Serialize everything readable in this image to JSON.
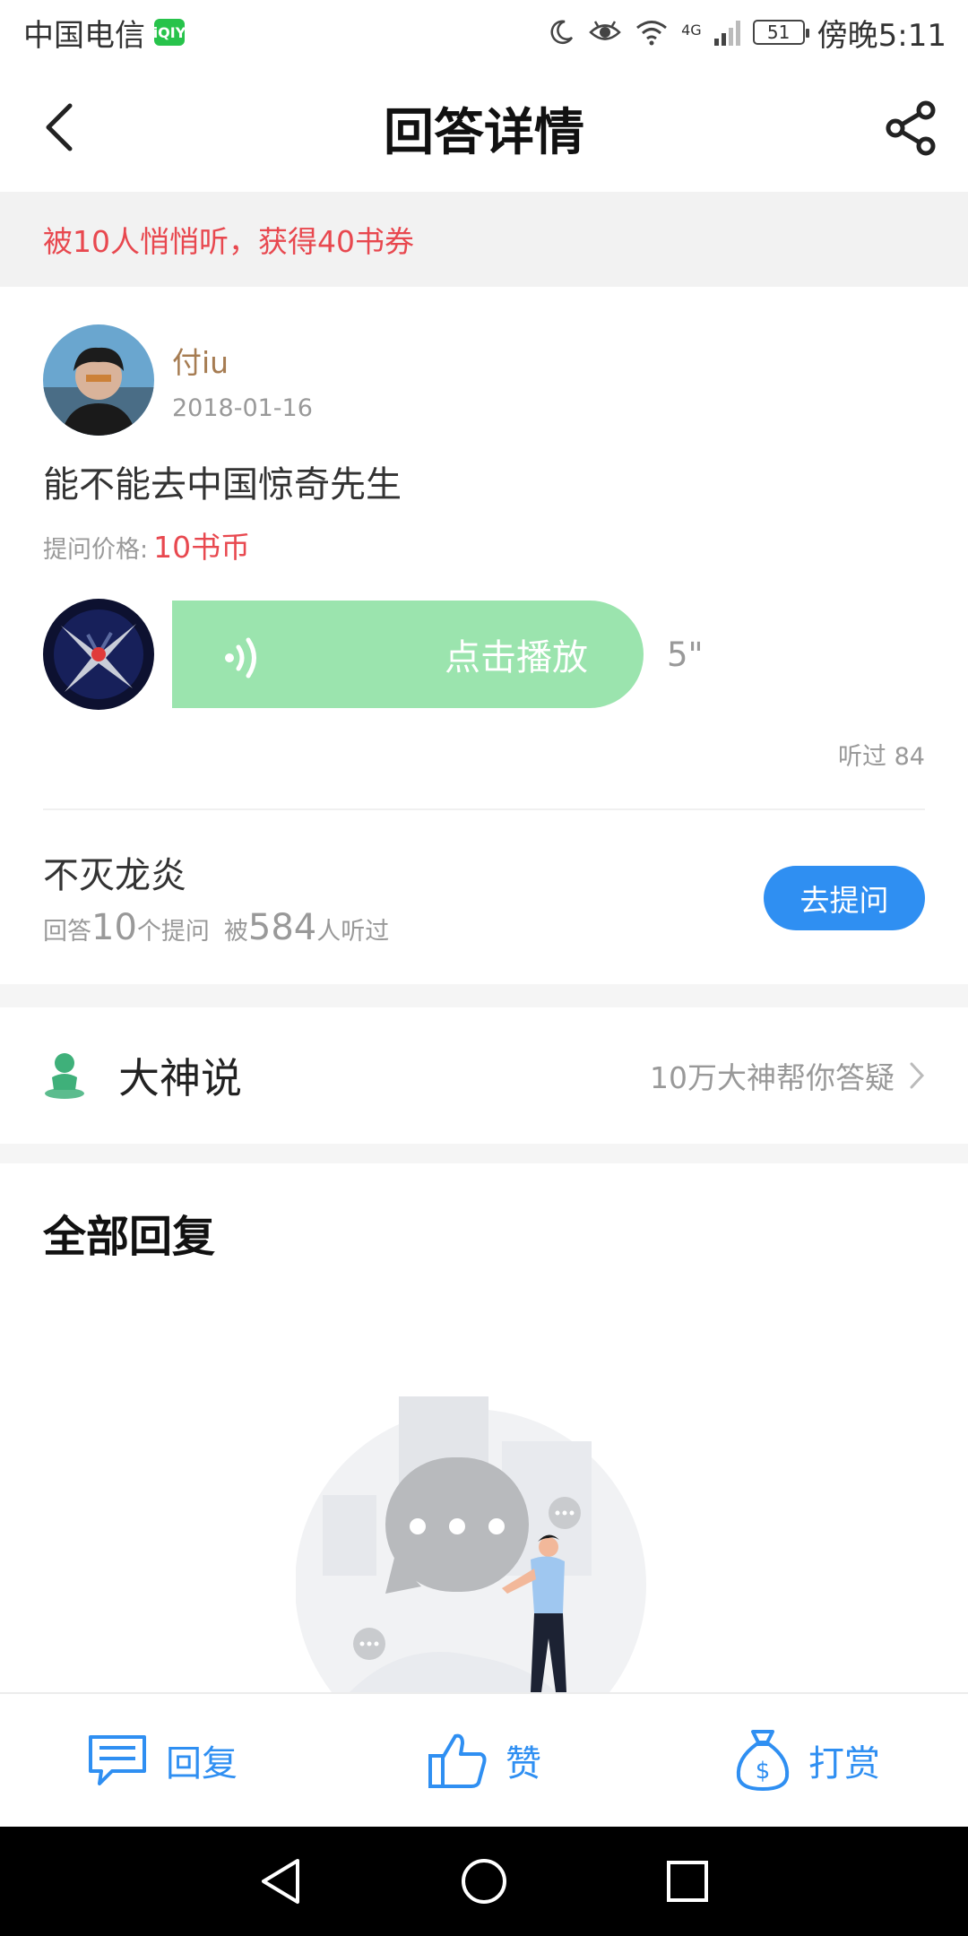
{
  "status_bar": {
    "carrier": "中国电信",
    "app_badge": "iQIY",
    "network": "4G",
    "battery": "51",
    "time": "傍晚5:11"
  },
  "header": {
    "title": "回答详情"
  },
  "notice": "被10人悄悄听，获得40书券",
  "question": {
    "asker_name": "付iu",
    "date": "2018-01-16",
    "text": "能不能去中国惊奇先生",
    "price_label": "提问价格:",
    "price_value": "10书币"
  },
  "answer": {
    "play_label": "点击播放",
    "duration": "5\"",
    "listened": "听过 84"
  },
  "answerer": {
    "name": "不灭龙炎",
    "stats_answer_prefix": "回答",
    "stats_answer_count": "10",
    "stats_answer_suffix": "个提问",
    "stats_listen_prefix": "被",
    "stats_listen_count": "584",
    "stats_listen_suffix": "人听过",
    "ask_button": "去提问"
  },
  "dashen": {
    "title": "大神说",
    "subtitle": "10万大神帮你答疑"
  },
  "replies": {
    "section_title": "全部回复"
  },
  "bottom_bar": {
    "reply": "回复",
    "like": "赞",
    "tip": "打赏"
  },
  "colors": {
    "accent_blue": "#2f8ff2",
    "notice_red": "#e8484f",
    "play_green": "#9be4ae",
    "name_brown": "#a67c52"
  }
}
